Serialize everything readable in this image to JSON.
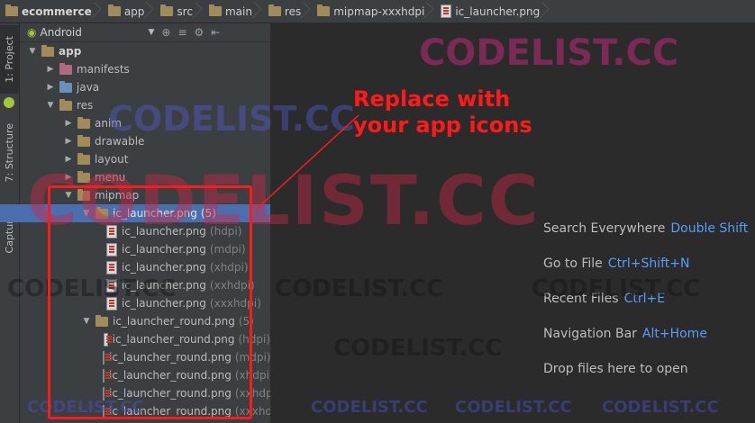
{
  "breadcrumb": [
    {
      "label": "ecommerce",
      "icon": "folder-icon"
    },
    {
      "label": "app",
      "icon": "folder-icon"
    },
    {
      "label": "src",
      "icon": "folder-icon"
    },
    {
      "label": "main",
      "icon": "folder-icon"
    },
    {
      "label": "res",
      "icon": "folder-icon"
    },
    {
      "label": "mipmap-xxxhdpi",
      "icon": "folder-icon"
    },
    {
      "label": "ic_launcher.png",
      "icon": "image-file-icon"
    }
  ],
  "side_tabs": [
    "1: Project",
    "7: Structure",
    "Captures"
  ],
  "project_panel": {
    "view_selector": "Android",
    "tree": [
      {
        "label": "app",
        "level": 0,
        "expanded": true,
        "icon": "module-folder",
        "bold": true
      },
      {
        "label": "manifests",
        "level": 1,
        "expanded": false,
        "icon": "folder-pink"
      },
      {
        "label": "java",
        "level": 1,
        "expanded": false,
        "icon": "folder-blue"
      },
      {
        "label": "res",
        "level": 1,
        "expanded": true,
        "icon": "folder-res"
      },
      {
        "label": "anim",
        "level": 2,
        "expanded": false,
        "icon": "folder"
      },
      {
        "label": "drawable",
        "level": 2,
        "expanded": false,
        "icon": "folder"
      },
      {
        "label": "layout",
        "level": 2,
        "expanded": false,
        "icon": "folder"
      },
      {
        "label": "menu",
        "level": 2,
        "expanded": false,
        "icon": "folder"
      },
      {
        "label": "mipmap",
        "level": 2,
        "expanded": true,
        "icon": "folder"
      },
      {
        "label": "ic_launcher.png",
        "suffix": "(5)",
        "level": 3,
        "expanded": true,
        "icon": "folder",
        "selected": true
      },
      {
        "label": "ic_launcher.png",
        "suffix": "(hdpi)",
        "level": 4,
        "icon": "image-file"
      },
      {
        "label": "ic_launcher.png",
        "suffix": "(mdpi)",
        "level": 4,
        "icon": "image-file"
      },
      {
        "label": "ic_launcher.png",
        "suffix": "(xhdpi)",
        "level": 4,
        "icon": "image-file"
      },
      {
        "label": "ic_launcher.png",
        "suffix": "(xxhdpi)",
        "level": 4,
        "icon": "image-file"
      },
      {
        "label": "ic_launcher.png",
        "suffix": "(xxxhdpi)",
        "level": 4,
        "icon": "image-file"
      },
      {
        "label": "ic_launcher_round.png",
        "suffix": "(5)",
        "level": 3,
        "expanded": true,
        "icon": "folder"
      },
      {
        "label": "ic_launcher_round.png",
        "suffix": "(hdpi)",
        "level": 4,
        "icon": "image-file"
      },
      {
        "label": "ic_launcher_round.png",
        "suffix": "(mdpi)",
        "level": 4,
        "icon": "image-file"
      },
      {
        "label": "ic_launcher_round.png",
        "suffix": "(xhdpi)",
        "level": 4,
        "icon": "image-file"
      },
      {
        "label": "ic_launcher_round.png",
        "suffix": "(xxhdpi)",
        "level": 4,
        "icon": "image-file"
      },
      {
        "label": "ic_launcher_round.png",
        "suffix": "(xxxhdpi)",
        "level": 4,
        "icon": "image-file"
      }
    ]
  },
  "editor_hints": [
    {
      "label": "Search Everywhere",
      "key": "Double Shift"
    },
    {
      "label": "Go to File",
      "key": "Ctrl+Shift+N"
    },
    {
      "label": "Recent Files",
      "key": "Ctrl+E"
    },
    {
      "label": "Navigation Bar",
      "key": "Alt+Home"
    },
    {
      "label": "Drop files here to open",
      "key": ""
    }
  ],
  "annotation": {
    "line1": "Replace with",
    "line2": "your app icons",
    "color": "#ff1a1a"
  },
  "watermark": "CODELIST.CC",
  "colors": {
    "accent_key": "#589df6",
    "selection": "#4b6eaf",
    "android_green": "#a4c639"
  }
}
